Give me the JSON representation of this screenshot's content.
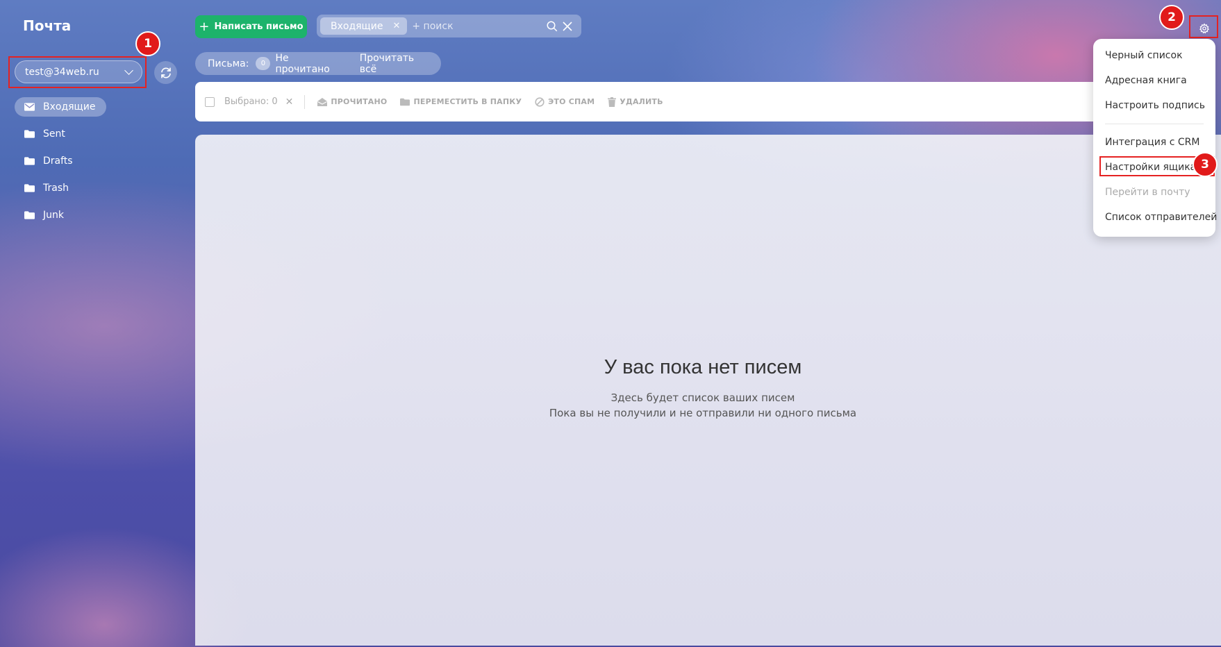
{
  "sidebar": {
    "title": "Почта",
    "account": "test@34web.ru",
    "folders": [
      {
        "label": "Входящие",
        "active": true
      },
      {
        "label": "Sent"
      },
      {
        "label": "Drafts"
      },
      {
        "label": "Trash"
      },
      {
        "label": "Junk"
      }
    ]
  },
  "header": {
    "compose_label": "Написать письмо",
    "search_chip": "Входящие",
    "search_placeholder": "+ поиск"
  },
  "summary": {
    "label": "Письма:",
    "unread_count": "0",
    "unread_label": "Не прочитано",
    "read_all": "Прочитать всё"
  },
  "toolbar": {
    "selected": "Выбрано: 0",
    "actions": [
      "ПРОЧИТАНО",
      "ПЕРЕМЕСТИТЬ В ПАПКУ",
      "ЭТО СПАМ",
      "УДАЛИТЬ"
    ]
  },
  "empty": {
    "title": "У вас пока нет писем",
    "line1": "Здесь будет список ваших писем",
    "line2": "Пока вы не получили и не отправили ни одного письма"
  },
  "settings_menu": [
    {
      "label": "Черный список"
    },
    {
      "label": "Адресная книга"
    },
    {
      "label": "Настроить подпись"
    },
    {
      "label": "Интеграция с CRM"
    },
    {
      "label": "Настройки ящика",
      "highlighted": true
    },
    {
      "label": "Перейти в почту",
      "disabled": true
    },
    {
      "label": "Список отправителей"
    }
  ],
  "annotations": [
    "1",
    "2",
    "3"
  ],
  "colors": {
    "compose": "#1db36b",
    "highlight": "#e52222"
  }
}
